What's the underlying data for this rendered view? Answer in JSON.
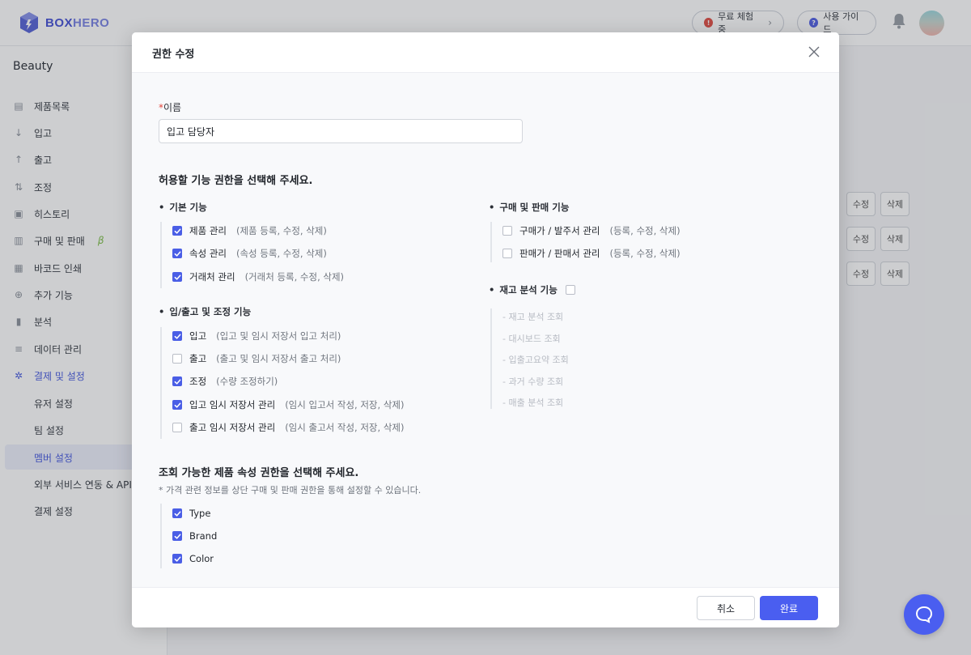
{
  "app": {
    "logo_box": "BOX",
    "logo_hero": "HERO",
    "workspace": "Beauty"
  },
  "topbar": {
    "trial_label": "무료 체험중",
    "guide_label": "사용 가이드"
  },
  "sidebar": {
    "items": [
      {
        "label": "제품목록",
        "icon": "box-icon"
      },
      {
        "label": "입고",
        "icon": "arrow-down-icon"
      },
      {
        "label": "출고",
        "icon": "arrow-up-icon"
      },
      {
        "label": "조정",
        "icon": "swap-icon"
      },
      {
        "label": "히스토리",
        "icon": "history-icon"
      },
      {
        "label": "구매 및 판매",
        "icon": "document-icon",
        "badge": "β"
      },
      {
        "label": "바코드 인쇄",
        "icon": "barcode-icon"
      },
      {
        "label": "추가 기능",
        "icon": "plus-circle-icon"
      },
      {
        "label": "분석",
        "icon": "chart-icon"
      },
      {
        "label": "데이터 관리",
        "icon": "database-icon"
      },
      {
        "label": "결제 및 설정",
        "icon": "gear-icon"
      }
    ],
    "sub_items": [
      "유저 설정",
      "팀 설정",
      "멤버 설정",
      "외부 서비스 연동 & API",
      "결제 설정"
    ]
  },
  "table": {
    "edit_label": "수정",
    "delete_label": "삭제"
  },
  "modal": {
    "title": "권한 수정",
    "name_label": "이름",
    "name_required_mark": "*",
    "name_value": "입고 담당자",
    "feature_section_title": "허용할 기능 권한을 선택해 주세요.",
    "basic": {
      "title": "기본 기능",
      "items": [
        {
          "label": "제품 관리",
          "desc": "(제품 등록, 수정, 삭제)",
          "checked": true
        },
        {
          "label": "속성 관리",
          "desc": "(속성 등록, 수정, 삭제)",
          "checked": true
        },
        {
          "label": "거래처 관리",
          "desc": "(거래처 등록, 수정, 삭제)",
          "checked": true
        }
      ]
    },
    "inout": {
      "title": "입/출고 및 조정 기능",
      "items": [
        {
          "label": "입고",
          "desc": "(입고 및 임시 저장서 입고 처리)",
          "checked": true
        },
        {
          "label": "출고",
          "desc": "(출고 및 임시 저장서 출고 처리)",
          "checked": false
        },
        {
          "label": "조정",
          "desc": "(수량 조정하기)",
          "checked": true
        },
        {
          "label": "입고 임시 저장서 관리",
          "desc": "(임시 입고서 작성, 저장, 삭제)",
          "checked": true
        },
        {
          "label": "출고 임시 저장서 관리",
          "desc": "(임시 출고서 작성, 저장, 삭제)",
          "checked": false
        }
      ]
    },
    "purchase": {
      "title": "구매 및 판매 기능",
      "items": [
        {
          "label": "구매가 / 발주서 관리",
          "desc": "(등록, 수정, 삭제)",
          "checked": false
        },
        {
          "label": "판매가 / 판매서 관리",
          "desc": "(등록, 수정, 삭제)",
          "checked": false
        }
      ]
    },
    "analysis": {
      "title": "재고 분석 기능",
      "checked": false,
      "items": [
        "- 재고 분석 조회",
        "- 대시보드 조회",
        "- 입출고요약 조회",
        "- 과거 수량 조회",
        "- 매출 분석 조회"
      ]
    },
    "attr_section_title": "조회 가능한 제품 속성 권한을 선택해 주세요.",
    "attr_note": "* 가격 관련 정보를 상단 구매 및 판매 권한을 통해 설정할 수 있습니다.",
    "attributes": [
      {
        "label": "Type",
        "checked": true
      },
      {
        "label": "Brand",
        "checked": true
      },
      {
        "label": "Color",
        "checked": true
      }
    ],
    "cancel_label": "취소",
    "confirm_label": "완료"
  },
  "colors": {
    "accent": "#4a5ef0",
    "checkbox": "#4a5ee6",
    "required": "#e3463b",
    "beta": "#7fbf4c"
  }
}
